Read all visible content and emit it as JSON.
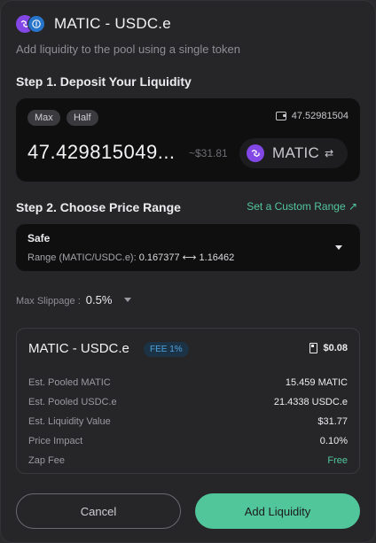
{
  "header": {
    "title": "MATIC - USDC.e",
    "subtitle": "Add liquidity to the pool using a single token"
  },
  "step1": {
    "title": "Step 1. Deposit Your Liquidity",
    "max_label": "Max",
    "half_label": "Half",
    "wallet_balance": "47.52981504",
    "amount": "47.429815049...",
    "usd_value": "~$31.81",
    "token": "MATIC"
  },
  "step2": {
    "title": "Step 2. Choose Price Range",
    "custom_range_label": "Set a Custom Range ↗",
    "range_name": "Safe",
    "range_label": "Range (MATIC/USDC.e):",
    "range_low": "0.167377",
    "range_arrow": "⟷",
    "range_high": "1.16462"
  },
  "slippage": {
    "label": "Max Slippage :",
    "value": "0.5%"
  },
  "summary": {
    "title": "MATIC - USDC.e",
    "fee_badge": "FEE 1%",
    "gas_cost": "$0.08",
    "rows": [
      {
        "key": "Est. Pooled MATIC",
        "value": "15.459 MATIC"
      },
      {
        "key": "Est. Pooled USDC.e",
        "value": "21.4338 USDC.e"
      },
      {
        "key": "Est. Liquidity Value",
        "value": "$31.77"
      },
      {
        "key": "Price Impact",
        "value": "0.10%"
      },
      {
        "key": "Zap Fee",
        "value": "Free"
      }
    ]
  },
  "buttons": {
    "cancel": "Cancel",
    "add": "Add Liquidity"
  },
  "colors": {
    "accent": "#52c69b",
    "matic": "#8247e5",
    "usdc": "#2775ca",
    "fee_badge": "#4fa3dc"
  }
}
